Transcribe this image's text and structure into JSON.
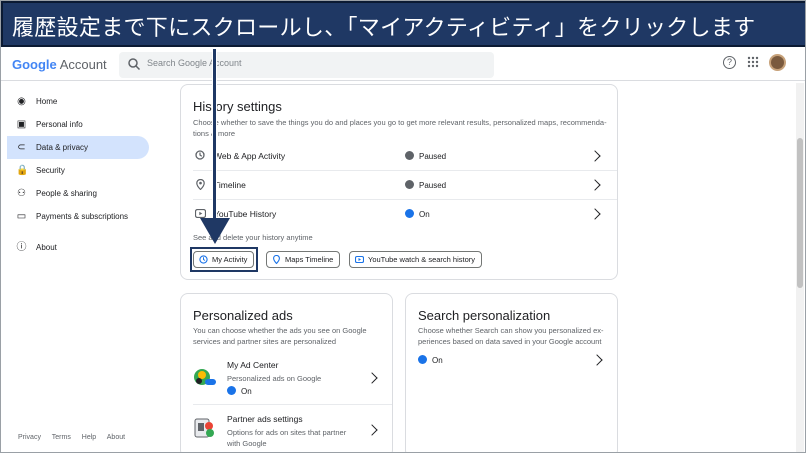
{
  "banner": {
    "text": "履歴設定まで下にスクロールし、「マイアクティビティ」をクリックします"
  },
  "header": {
    "logo_google": "Google",
    "logo_account": "Account",
    "search_placeholder": "Search Google Account"
  },
  "sidebar": {
    "items": [
      {
        "label": "Home",
        "icon": "home-icon",
        "glyph": "◉"
      },
      {
        "label": "Personal info",
        "icon": "id-card-icon",
        "glyph": "▣"
      },
      {
        "label": "Data & privacy",
        "icon": "toggle-icon",
        "glyph": "⊂"
      },
      {
        "label": "Security",
        "icon": "lock-icon",
        "glyph": "🔒"
      },
      {
        "label": "People & sharing",
        "icon": "people-icon",
        "glyph": "⚇"
      },
      {
        "label": "Payments & subscriptions",
        "icon": "credit-card-icon",
        "glyph": "▭"
      },
      {
        "label": "About",
        "icon": "info-icon",
        "glyph": "ⓘ"
      }
    ],
    "footer": [
      "Privacy",
      "Terms",
      "Help",
      "About"
    ]
  },
  "history": {
    "title": "History settings",
    "description_line1": "Choose whether to save the things you do and places you go to get more relevant results, personalized maps, recommenda-",
    "description_line2": "tions & more",
    "rows": [
      {
        "label": "Web & App Activity",
        "status": "Paused"
      },
      {
        "label": "Timeline",
        "status": "Paused"
      },
      {
        "label": "YouTube History",
        "status": "On"
      }
    ],
    "manage_text": "See and delete your history anytime",
    "chips": {
      "my_activity": "My Activity",
      "maps_timeline": "Maps Timeline",
      "youtube": "YouTube watch & search history"
    }
  },
  "ads": {
    "title": "Personalized ads",
    "description_line1": "You can choose whether the ads you see on Google",
    "description_line2": "services and partner sites are personalized",
    "ad_center": {
      "title": "My Ad Center",
      "subtitle": "Personalized ads on Google",
      "status": "On"
    },
    "partner": {
      "title": "Partner ads settings",
      "subtitle_line1": "Options for ads on sites that partner",
      "subtitle_line2": "with Google"
    }
  },
  "search_personalization": {
    "title": "Search personalization",
    "description_line1": "Choose whether Search can show you personalized ex-",
    "description_line2": "periences based on data saved in your Google account",
    "status": "On"
  },
  "colors": {
    "banner": "#1f3864",
    "active_nav": "#d3e3fd",
    "accent": "#1a73e8"
  }
}
